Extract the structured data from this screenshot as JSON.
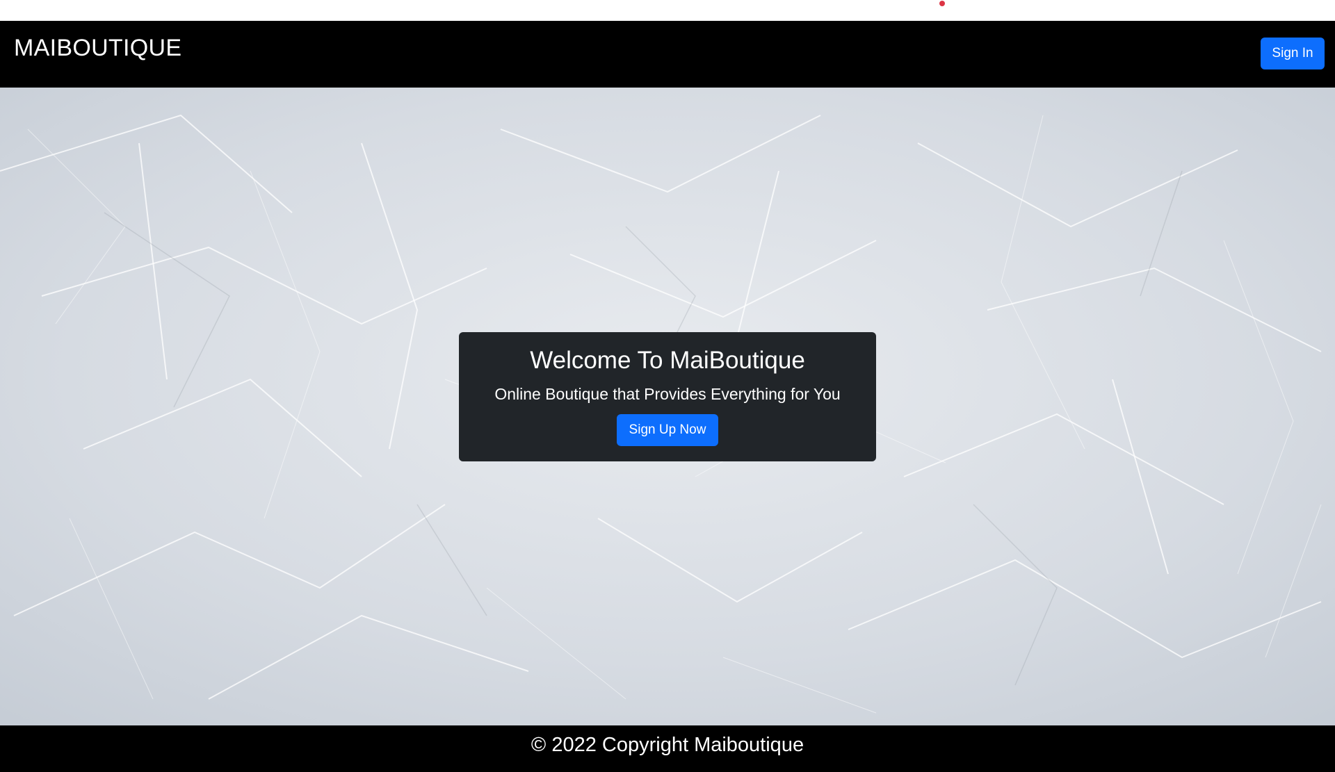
{
  "colors": {
    "navbar_bg": "#000000",
    "primary_button": "#0d6efd",
    "card_bg": "#212529",
    "footer_bg": "#000000",
    "indicator_dot": "#dc3545"
  },
  "navbar": {
    "brand": "MAIBOUTIQUE",
    "sign_in_label": "Sign In"
  },
  "hero": {
    "background": "frost-ice-texture",
    "title": "Welcome To MaiBoutique",
    "subtitle": "Online Boutique that Provides Everything for You",
    "cta_label": "Sign Up Now"
  },
  "footer": {
    "copyright": "© 2022 Copyright Maiboutique"
  }
}
